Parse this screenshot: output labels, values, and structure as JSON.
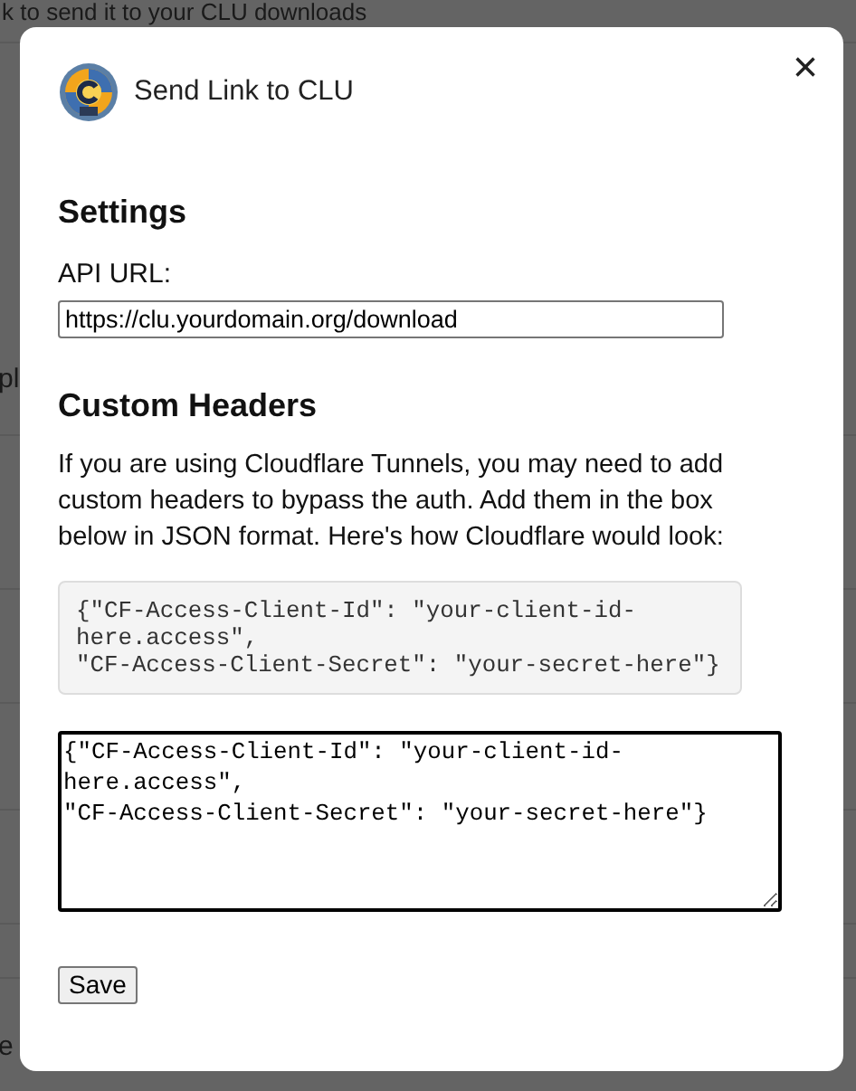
{
  "background": {
    "top_text": "k to send it to your CLU downloads",
    "side_fragments": [
      "pl",
      "e"
    ]
  },
  "dialog": {
    "title": "Send Link to CLU",
    "close": "×",
    "settings_heading": "Settings",
    "api_url": {
      "label": "API URL:",
      "value": "https://clu.yourdomain.org/download"
    },
    "headers_heading": "Custom Headers",
    "description": "If you are using Cloudflare Tunnels, you may need to add custom headers to bypass the auth. Add them in the box below in JSON format. Here's how Cloudflare would look:",
    "example": "{\"CF-Access-Client-Id\": \"your-client-id-here.access\",\n\"CF-Access-Client-Secret\": \"your-secret-here\"}",
    "headers_value": "{\"CF-Access-Client-Id\": \"your-client-id-here.access\",\n\"CF-Access-Client-Secret\": \"your-secret-here\"}",
    "save_button": "Save"
  }
}
